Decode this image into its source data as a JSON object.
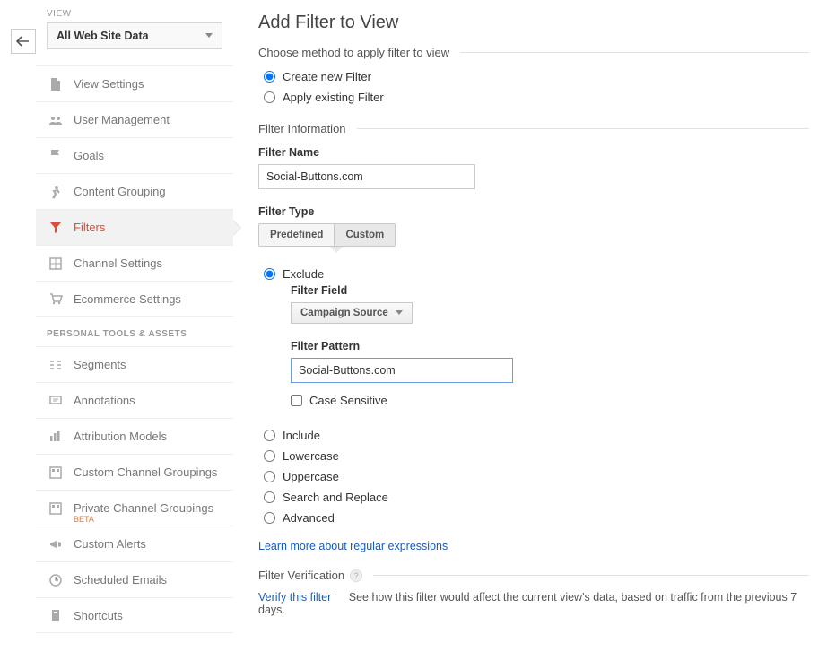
{
  "sidebar": {
    "view_label": "VIEW",
    "view_select_value": "All Web Site Data",
    "items": [
      {
        "label": "View Settings",
        "icon": "page-icon"
      },
      {
        "label": "User Management",
        "icon": "users-icon"
      },
      {
        "label": "Goals",
        "icon": "flag-icon"
      },
      {
        "label": "Content Grouping",
        "icon": "person-run-icon"
      },
      {
        "label": "Filters",
        "icon": "funnel-icon",
        "active": true
      },
      {
        "label": "Channel Settings",
        "icon": "channel-icon"
      },
      {
        "label": "Ecommerce Settings",
        "icon": "cart-icon"
      }
    ],
    "personal_label": "PERSONAL TOOLS & ASSETS",
    "personal_items": [
      {
        "label": "Segments",
        "icon": "segments-icon"
      },
      {
        "label": "Annotations",
        "icon": "annotations-icon"
      },
      {
        "label": "Attribution Models",
        "icon": "bars-icon"
      },
      {
        "label": "Custom Channel Groupings",
        "icon": "grouping-icon"
      },
      {
        "label": "Private Channel Groupings",
        "icon": "grouping-icon",
        "beta": "BETA"
      },
      {
        "label": "Custom Alerts",
        "icon": "megaphone-icon"
      },
      {
        "label": "Scheduled Emails",
        "icon": "clock-icon"
      },
      {
        "label": "Shortcuts",
        "icon": "shortcut-icon"
      }
    ]
  },
  "main": {
    "title": "Add Filter to View",
    "method_legend": "Choose method to apply filter to view",
    "method_options": {
      "create": "Create new Filter",
      "apply": "Apply existing Filter"
    },
    "info_legend": "Filter Information",
    "filter_name_label": "Filter Name",
    "filter_name_value": "Social-Buttons.com",
    "filter_type_label": "Filter Type",
    "tabs": {
      "predefined": "Predefined",
      "custom": "Custom"
    },
    "exclude_label": "Exclude",
    "filter_field_label": "Filter Field",
    "filter_field_value": "Campaign Source",
    "filter_pattern_label": "Filter Pattern",
    "filter_pattern_value": "Social-Buttons.com",
    "case_sensitive_label": "Case Sensitive",
    "other_options": [
      "Include",
      "Lowercase",
      "Uppercase",
      "Search and Replace",
      "Advanced"
    ],
    "learn_more": "Learn more about regular expressions",
    "verification_legend": "Filter Verification",
    "verify_link": "Verify this filter",
    "verify_text": "See how this filter would affect the current view's data, based on traffic from the previous 7 days."
  }
}
